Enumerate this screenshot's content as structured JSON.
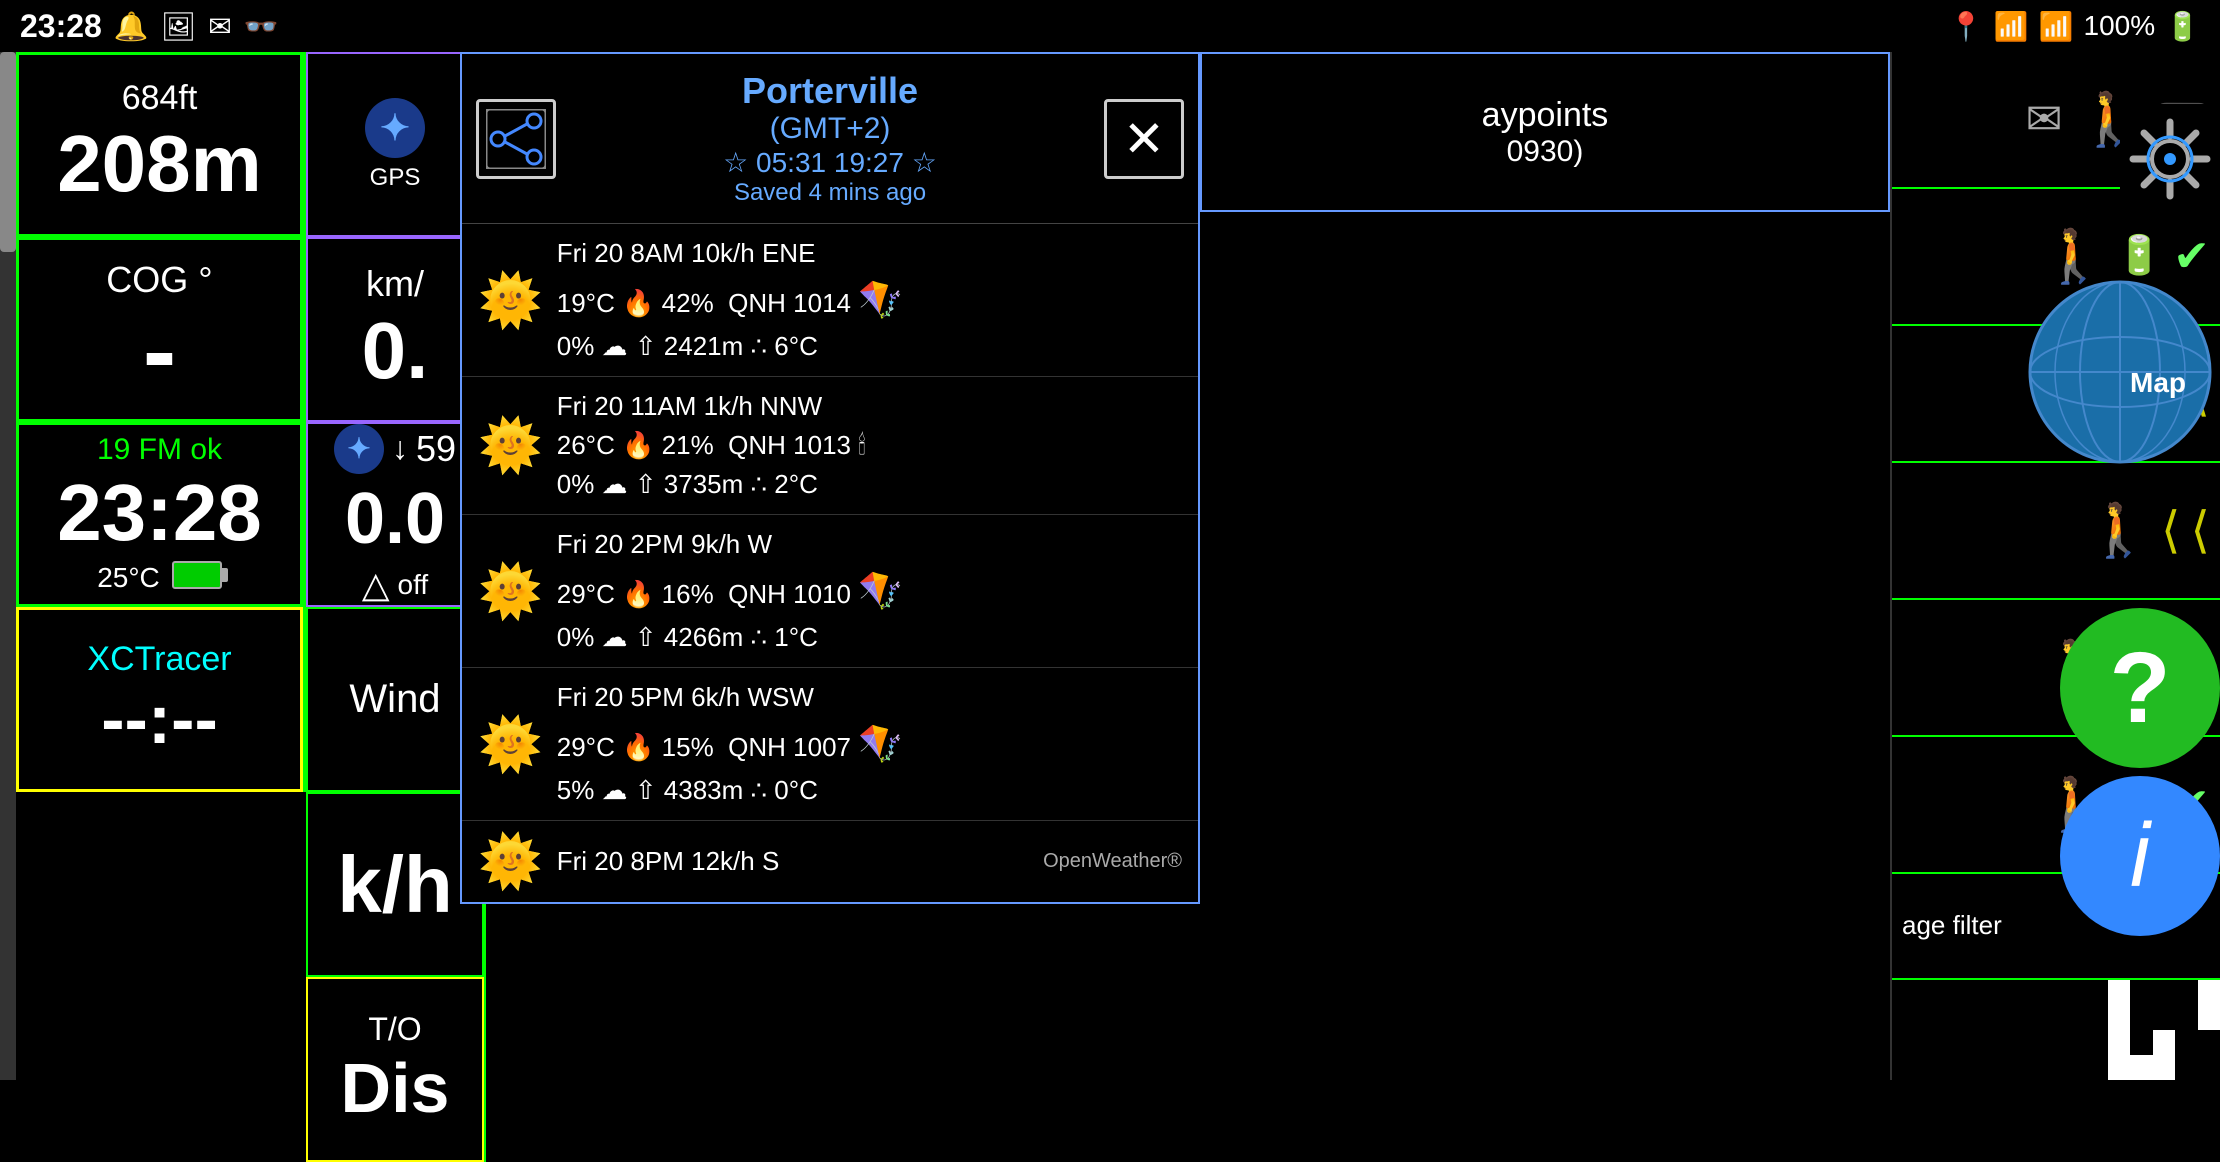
{
  "statusBar": {
    "time": "23:28",
    "batteryPercent": "100%",
    "icons": [
      "notification",
      "image",
      "mail",
      "glasses",
      "location",
      "wifi",
      "signal"
    ]
  },
  "leftPanel": {
    "altitude": {
      "ft": "684ft",
      "m": "208m"
    },
    "cog": {
      "label": "COG °",
      "value": "-"
    },
    "time": {
      "fm": "19 FM ok",
      "value": "23:28",
      "temp": "25°C"
    },
    "xctracer": {
      "label": "XCTracer",
      "value": "--:--"
    }
  },
  "midPanel": {
    "bluetooth": {
      "label": "GPS"
    },
    "speedTop": {
      "unit": "km/",
      "value": "0."
    },
    "btSpeed": {
      "arrow": "↓",
      "value": "59",
      "speedVal": "0.0",
      "off": "off"
    },
    "wind": {
      "label": "Wind"
    },
    "speedUnit": "k/h",
    "to": {
      "label": "T/O",
      "value": "Dis"
    }
  },
  "weather": {
    "city": "Porterville",
    "gmt": "(GMT+2)",
    "sunriseSunset": "☆ 05:31  19:27 ☆",
    "savedAgo": "Saved 4 mins ago",
    "rows": [
      {
        "icon": "☀️",
        "line1": "Fri 20 8AM  10k/h  ENE",
        "line2": "19°C 🌡 42%  QNH 1014",
        "line3": "0%  ☁  ⇧ 2421m  ∴ 6°C",
        "windIcon": "🪁"
      },
      {
        "icon": "☀️",
        "line1": "Fri 20 11AM  1k/h  NNW",
        "line2": "26°C 🌡 21%  QNH 1013",
        "line3": "0%  ☁  ⇧ 3735m  ∴ 2°C",
        "windIcon": "🪁"
      },
      {
        "icon": "☀️",
        "line1": "Fri 20 2PM  9k/h  W",
        "line2": "29°C 🌡 16%  QNH 1010",
        "line3": "0%  ☁  ⇧ 4266m  ∴ 1°C",
        "windIcon": "🪁"
      },
      {
        "icon": "☀️",
        "line1": "Fri 20 5PM  6k/h  WSW",
        "line2": "29°C 🌡 15%  QNH 1007",
        "line3": "5%  ☁  ⇧ 4383m  ∴ 0°C",
        "windIcon": "🪁"
      },
      {
        "icon": "☀️",
        "line1": "Fri 20 8PM  12k/h  S",
        "line2": "",
        "line3": "",
        "windIcon": ""
      }
    ],
    "attribution": "OpenWeather®"
  },
  "waypoints": {
    "label": "aypoints",
    "sub": "0930)"
  },
  "rightPanel": {
    "mapLabel": "Map",
    "ageFilter": "age filter",
    "gearLabel": "Settings"
  }
}
